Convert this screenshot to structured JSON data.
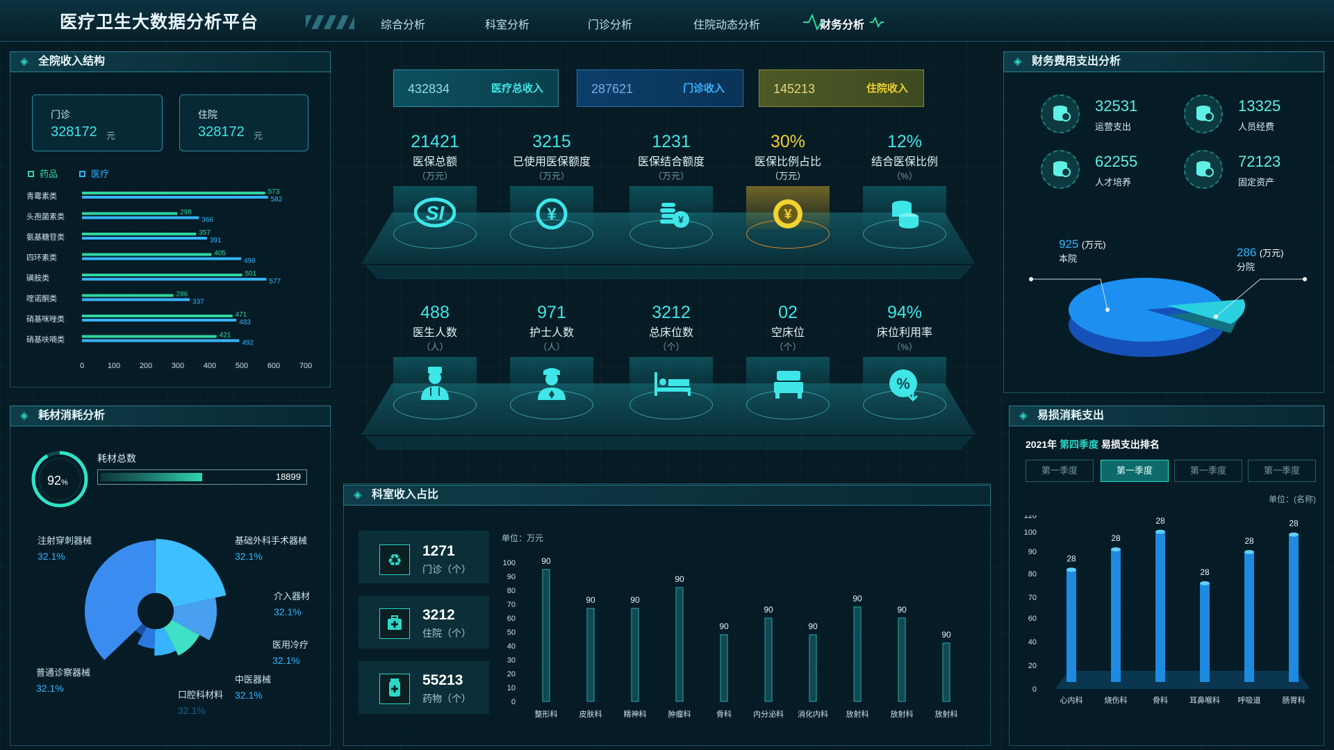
{
  "app": {
    "title": "医疗卫生大数据分析平台"
  },
  "nav": [
    "综合分析",
    "科室分析",
    "门诊分析",
    "住院动态分析",
    "财务分析"
  ],
  "left_top": {
    "title": "全院收入结构",
    "cards": [
      {
        "label": "门诊",
        "value": "328172",
        "unit": "元"
      },
      {
        "label": "住院",
        "value": "328172",
        "unit": "元"
      }
    ],
    "legend": [
      "药品",
      "医疗"
    ]
  },
  "left_bottom": {
    "title": "耗材消耗分析",
    "percent": "92",
    "percent_unit": "%",
    "total_label": "耗材总数",
    "total_value": "18899",
    "labels": [
      {
        "name": "注射穿刺器械",
        "pct": "32.1%"
      },
      {
        "name": "基础外科手术器械",
        "pct": "32.1%"
      },
      {
        "name": "介入器材",
        "pct": "32.1%"
      },
      {
        "name": "医用冷疗",
        "pct": "32.1%"
      },
      {
        "name": "中医器械",
        "pct": "32.1%"
      },
      {
        "name": "口腔科材料",
        "pct": "32.1%"
      },
      {
        "name": "普通诊察器械",
        "pct": "32.1%"
      }
    ]
  },
  "center": {
    "kpis": [
      {
        "value": "432834",
        "label": "医疗总收入"
      },
      {
        "value": "287621",
        "label": "门诊收入"
      },
      {
        "value": "145213",
        "label": "住院收入"
      }
    ],
    "row1": [
      {
        "value": "21421",
        "label": "医保总额",
        "unit": "（万元）",
        "icon": "si-icon"
      },
      {
        "value": "3215",
        "label": "已使用医保额度",
        "unit": "（万元）",
        "icon": "yen-icon"
      },
      {
        "value": "1231",
        "label": "医保结合额度",
        "unit": "（万元）",
        "icon": "coins-yen-icon"
      },
      {
        "value": "30%",
        "label": "医保比例占比",
        "unit": "（万元）",
        "icon": "yen-coin-icon"
      },
      {
        "value": "12%",
        "label": "结合医保比例",
        "unit": "（%）",
        "icon": "coin-stack-icon"
      }
    ],
    "row2": [
      {
        "value": "488",
        "label": "医生人数",
        "unit": "（人）",
        "icon": "doctor-icon"
      },
      {
        "value": "971",
        "label": "护士人数",
        "unit": "（人）",
        "icon": "nurse-icon"
      },
      {
        "value": "3212",
        "label": "总床位数",
        "unit": "（个）",
        "icon": "bed-icon"
      },
      {
        "value": "02",
        "label": "空床位",
        "unit": "（个）",
        "icon": "empty-bed-icon"
      },
      {
        "value": "94%",
        "label": "床位利用率",
        "unit": "（%）",
        "icon": "percent-icon"
      }
    ],
    "dept": {
      "title": "科室收入占比",
      "unit": "单位：万元",
      "stats": [
        {
          "value": "1271",
          "label": "门诊（个）",
          "icon": "recycle-icon"
        },
        {
          "value": "3212",
          "label": "住院（个）",
          "icon": "medkit-icon"
        },
        {
          "value": "55213",
          "label": "药物（个）",
          "icon": "medicine-icon"
        }
      ]
    }
  },
  "right_top": {
    "title": "财务费用支出分析",
    "stats": [
      {
        "value": "32531",
        "label": "运营支出"
      },
      {
        "value": "13325",
        "label": "人员经费"
      },
      {
        "value": "62255",
        "label": "人才培养"
      },
      {
        "value": "72123",
        "label": "固定资产"
      }
    ],
    "pie": {
      "a_value": "925",
      "a_unit": "(万元)",
      "a_label": "本院",
      "b_value": "286",
      "b_unit": "(万元)",
      "b_label": "分院"
    }
  },
  "right_bottom": {
    "title": "易损消耗支出",
    "sub_year": "2021年",
    "sub_q": "第四季度",
    "sub_rest": "易损支出排名",
    "tabs": [
      "第一季度",
      "第一季度",
      "第一季度",
      "第一季度"
    ],
    "unit": "单位：(名称)"
  },
  "chart_data": [
    {
      "type": "bar",
      "orientation": "horizontal",
      "categories": [
        "青霉素类",
        "头孢菌素类",
        "氨基糖苷类",
        "四环素类",
        "磺胺类",
        "喹诺酮类",
        "硝基咪唑类",
        "硝基呋喃类"
      ],
      "series": [
        {
          "name": "药品",
          "values": [
            573,
            298,
            357,
            405,
            501,
            286,
            471,
            421
          ]
        },
        {
          "name": "医疗",
          "values": [
            582,
            366,
            391,
            498,
            577,
            337,
            483,
            492
          ]
        }
      ],
      "xlim": [
        0,
        700
      ],
      "xticks": [
        "0",
        "100",
        "200",
        "300",
        "400",
        "500",
        "600",
        "700"
      ]
    },
    {
      "type": "pie",
      "slices": [
        {
          "name": "注射穿刺器械",
          "value": 32.1
        },
        {
          "name": "基础外科手术器械",
          "value": 32.1
        },
        {
          "name": "介入器材",
          "value": 32.1
        },
        {
          "name": "医用冷疗",
          "value": 32.1
        },
        {
          "name": "中医器械",
          "value": 32.1
        },
        {
          "name": "口腔科材料",
          "value": 32.1
        },
        {
          "name": "普通诊察器械",
          "value": 32.1
        }
      ]
    },
    {
      "type": "bar",
      "categories": [
        "整形科",
        "皮肤科",
        "精神科",
        "肿瘤科",
        "骨科",
        "内分泌科",
        "消化内科",
        "放射科",
        "放射科",
        "放射科"
      ],
      "values": [
        90,
        90,
        90,
        90,
        90,
        90,
        90,
        90,
        90,
        90
      ],
      "heights_reading": [
        95,
        67,
        67,
        82,
        48,
        60,
        48,
        68,
        60,
        42
      ],
      "ylim": [
        0,
        100
      ],
      "yticks": [
        "0",
        "10",
        "20",
        "30",
        "40",
        "50",
        "60",
        "70",
        "80",
        "90",
        "100"
      ]
    },
    {
      "type": "pie",
      "slices": [
        {
          "name": "本院",
          "value": 925
        },
        {
          "name": "分院",
          "value": 286
        }
      ]
    },
    {
      "type": "bar",
      "categories": [
        "心内科",
        "烧伤科",
        "骨科",
        "耳鼻喉科",
        "呼吸道",
        "肠胃科"
      ],
      "values": [
        28,
        28,
        28,
        28,
        28,
        28
      ],
      "heights_reading": [
        88,
        103,
        116,
        78,
        101,
        114
      ],
      "ylim": [
        0,
        120
      ],
      "yticks": [
        "0",
        "20",
        "40",
        "60",
        "70",
        "80",
        "90",
        "100",
        "120"
      ]
    }
  ]
}
